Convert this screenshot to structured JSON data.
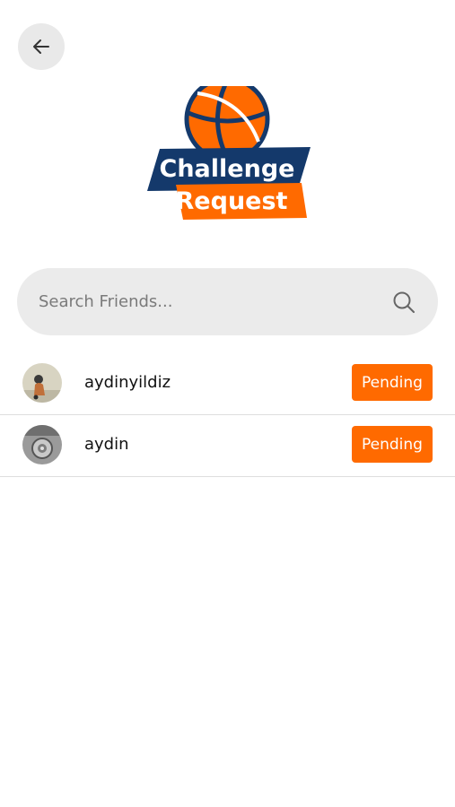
{
  "header": {
    "back_label": "Back"
  },
  "logo": {
    "line1": "Challenge",
    "line2": "Request",
    "colors": {
      "navy": "#14396b",
      "orange": "#ff6a00"
    }
  },
  "search": {
    "placeholder": "Search Friends...",
    "value": ""
  },
  "friends": [
    {
      "username": "aydinyildiz",
      "status": "Pending",
      "avatar_icon": "person-photo"
    },
    {
      "username": "aydin",
      "status": "Pending",
      "avatar_icon": "device-photo"
    }
  ],
  "colors": {
    "accent": "#ff6a00",
    "search_bg": "#ebebeb",
    "back_bg": "#e9e9e9"
  }
}
